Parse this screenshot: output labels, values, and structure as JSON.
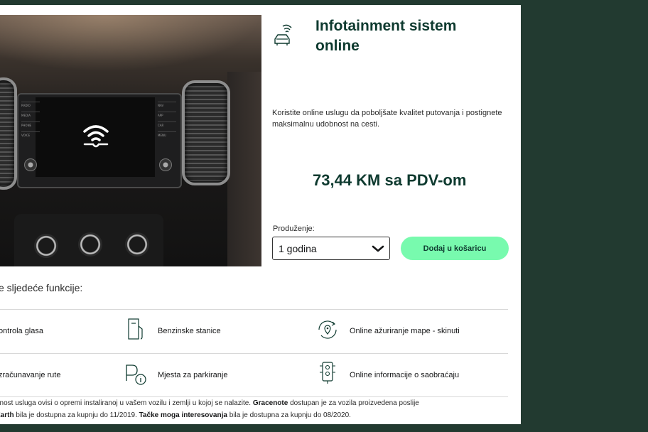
{
  "product": {
    "title": "Infotainment sistem online",
    "description": "Koristite online uslugu da poboljšate kvalitet putovanja i postignete maksimalnu udobnost na cesti.",
    "price": "73,44 KM sa PDV-om",
    "icon": "car-wifi-icon"
  },
  "hero_image": {
    "screen_left_buttons": [
      "RADIO",
      "MEDIA",
      "PHONE",
      "VOICE"
    ],
    "screen_right_buttons": [
      "NAV",
      "APP",
      "CAR",
      "MENU"
    ]
  },
  "extension": {
    "label": "Produženje:",
    "selected": "1 godina"
  },
  "cart_button": {
    "label": "Dodaj u košaricu"
  },
  "features": {
    "heading": "e sljedeće funkcije:",
    "items": [
      {
        "label": "ontrola glasa",
        "icon": ""
      },
      {
        "label": "Benzinske stanice",
        "icon": "fuel-pump-icon"
      },
      {
        "label": "Online ažuriranje mape - skinuti",
        "icon": "map-update-icon"
      },
      {
        "label": "zračunavanje rute",
        "icon": ""
      },
      {
        "label": "Mjesta za parkiranje",
        "icon": "parking-icon"
      },
      {
        "label": "Online informacije o saobraćaju",
        "icon": "traffic-light-icon"
      }
    ]
  },
  "footnote": {
    "line1_prefix": "pnost usluga ovisi o opremi instaliranoj u vašem vozilu i zemlji u kojoj se nalazite. ",
    "line1_bold": "Gracenote",
    "line1_suffix": " dostupan je za vozila proizvedena poslije",
    "line2_bold1": "Earth",
    "line2_mid": " bila je dostupna za kupnju do 11/2019. ",
    "line2_bold2": "Tačke moga interesovanja",
    "line2_suffix": " bila je dostupna za kupnju do 08/2020."
  },
  "colors": {
    "background": "#223a30",
    "accent_green": "#78faae",
    "title_green": "#0e3a2f"
  }
}
